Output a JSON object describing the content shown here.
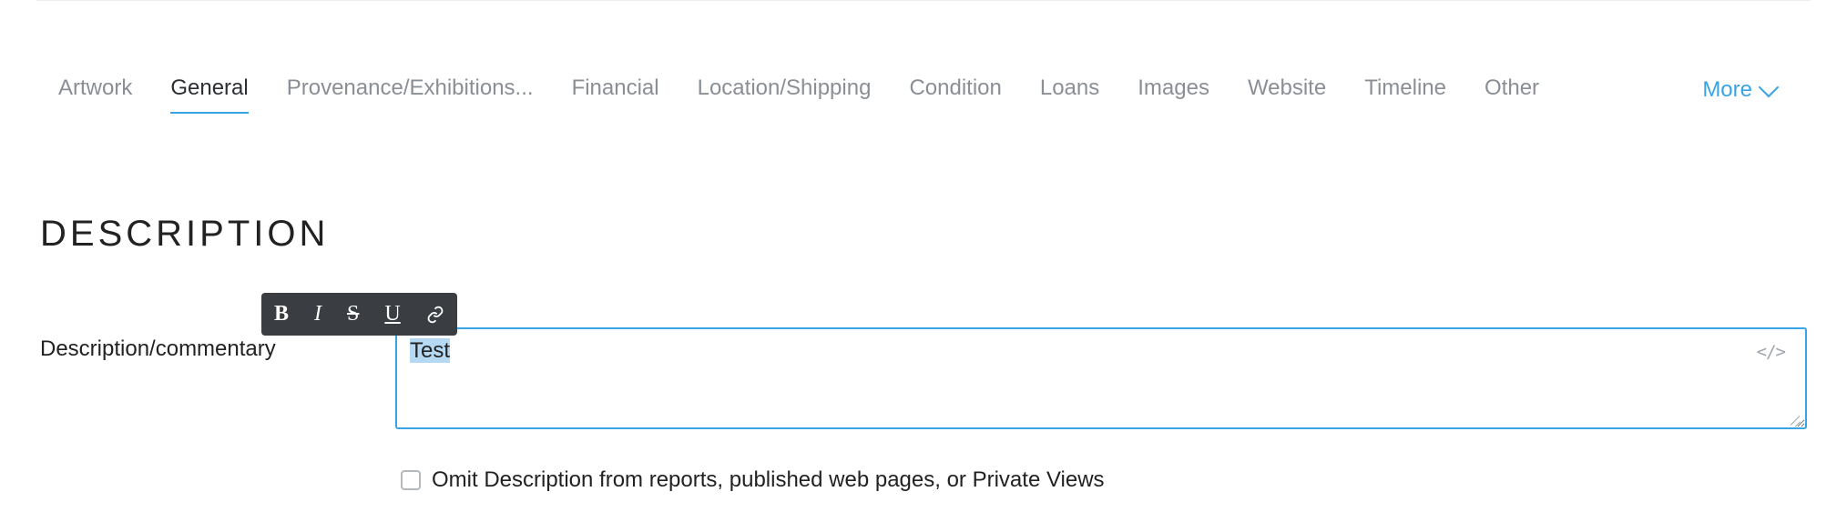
{
  "tabs": {
    "items": [
      {
        "label": "Artwork"
      },
      {
        "label": "General"
      },
      {
        "label": "Provenance/Exhibitions..."
      },
      {
        "label": "Financial"
      },
      {
        "label": "Location/Shipping"
      },
      {
        "label": "Condition"
      },
      {
        "label": "Loans"
      },
      {
        "label": "Images"
      },
      {
        "label": "Website"
      },
      {
        "label": "Timeline"
      },
      {
        "label": "Other"
      }
    ],
    "activeIndex": 1,
    "moreLabel": "More"
  },
  "section": {
    "title": "Description"
  },
  "description": {
    "fieldLabel": "Description/commentary",
    "value": "Test",
    "omitLabel": "Omit Description from reports, published web pages, or Private Views",
    "omitChecked": false
  },
  "toolbar": {
    "boldGlyph": "B",
    "italicGlyph": "I",
    "strikeGlyph": "S",
    "underlineGlyph": "U"
  },
  "icons": {
    "codeGlyph": "</>"
  }
}
